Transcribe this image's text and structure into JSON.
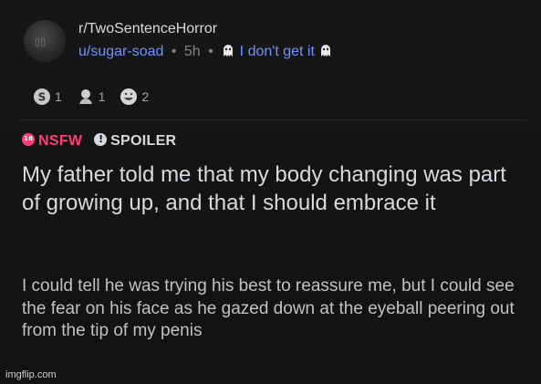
{
  "post": {
    "subreddit": "r/TwoSentenceHorror",
    "username": "u/sugar-soad",
    "separator": "•",
    "age": "5h",
    "flair": "I don't get it",
    "awards": [
      {
        "icon": "silver-award-icon",
        "count": "1"
      },
      {
        "icon": "helpful-award-icon",
        "count": "1"
      },
      {
        "icon": "laugh-award-icon",
        "count": "2"
      }
    ],
    "tags": {
      "nsfw": "NSFW",
      "spoiler": "SPOILER"
    },
    "title": "My father told me that my body changing was part of growing up, and that I should embrace it",
    "body": "I could tell he was trying his best to reassure me, but I could see the fear on his face as he gazed down at the eyeball peering out from the tip of my penis"
  },
  "watermark": "imgflip.com",
  "colors": {
    "background": "#121212",
    "username": "#7193ff",
    "nsfw": "#ff3d77",
    "text": "#d7dadc"
  }
}
